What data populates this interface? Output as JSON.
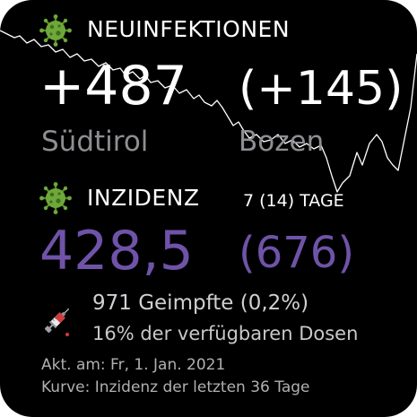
{
  "widget": {
    "new_infections": {
      "title": "NEUINFEKTIONEN",
      "suedtirol_value": "+487",
      "bozen_value": "(+145)",
      "suedtirol_label": "Südtirol",
      "bozen_label": "Bozen"
    },
    "incidence": {
      "title": "INZIDENZ",
      "days_label": "7 (14) TAGE",
      "suedtirol_value": "428,5",
      "bozen_value": "(676)"
    },
    "vaccination": {
      "vaccinated": "971 Geimpfte (0,2%)",
      "doses": "16% der verfügbaren Dosen"
    },
    "updated": "Akt. am: Fr, 1. Jan. 2021",
    "curve_caption": "Kurve: Inzidenz der letzten 36 Tage"
  },
  "colors": {
    "background": "#000000",
    "incidence_accent": "#6f53a8",
    "virus_green": "#6fa83a"
  },
  "icons": [
    "virus-icon",
    "syringe-icon"
  ]
}
